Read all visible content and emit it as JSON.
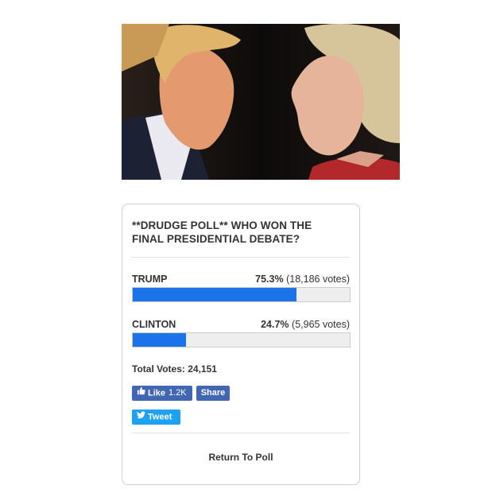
{
  "poll": {
    "title": "**DRUDGE POLL** WHO WON THE FINAL PRESIDENTIAL DEBATE?",
    "options": [
      {
        "name": "TRUMP",
        "percent_label": "75.3%",
        "votes_label": "(18,186 votes)",
        "share": 0.753
      },
      {
        "name": "CLINTON",
        "percent_label": "24.7%",
        "votes_label": "(5,965 votes)",
        "share": 0.247
      }
    ],
    "total_votes": "Total Votes: 24,151",
    "bar_color": "#1a73e8",
    "return_link": "Return To Poll"
  },
  "social": {
    "like_label": "Like",
    "like_count": "1.2K",
    "share_label": "Share",
    "tweet_label": "Tweet",
    "facebook_color": "#4267b2",
    "twitter_color": "#1da1f2"
  },
  "photo": {
    "icon": "debate-photo"
  }
}
